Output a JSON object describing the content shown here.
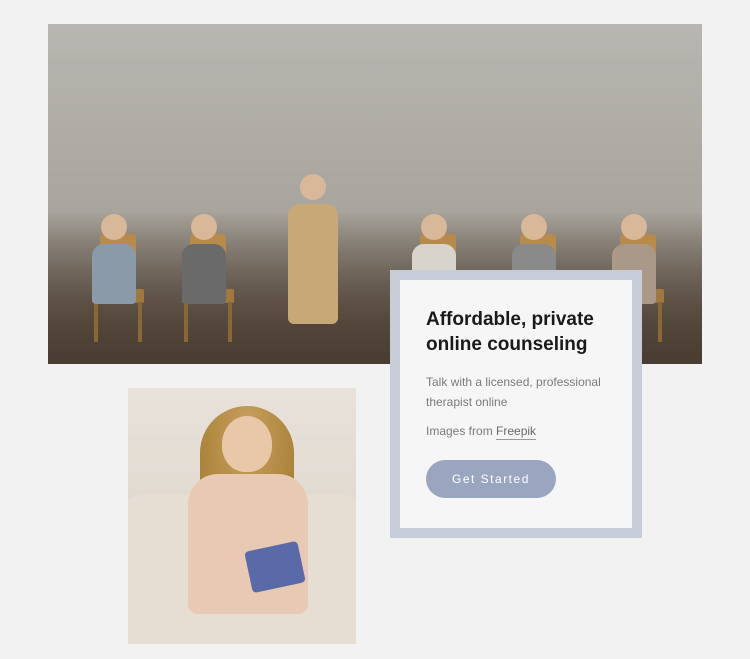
{
  "card": {
    "title": "Affordable, private online counseling",
    "subtitle": "Talk with a licensed, professional therapist online",
    "credit_prefix": "Images from ",
    "credit_link": "Freepik",
    "cta": "Get Started"
  },
  "images": {
    "hero_alt": "Group therapy session with people seated on wooden chairs and a facilitator standing",
    "secondary_alt": "Smiling female therapist with clipboard seated in armchair"
  },
  "colors": {
    "card_border": "#c6ccd8",
    "cta_bg": "#9aa6c0",
    "page_bg": "#f2f2f2"
  }
}
